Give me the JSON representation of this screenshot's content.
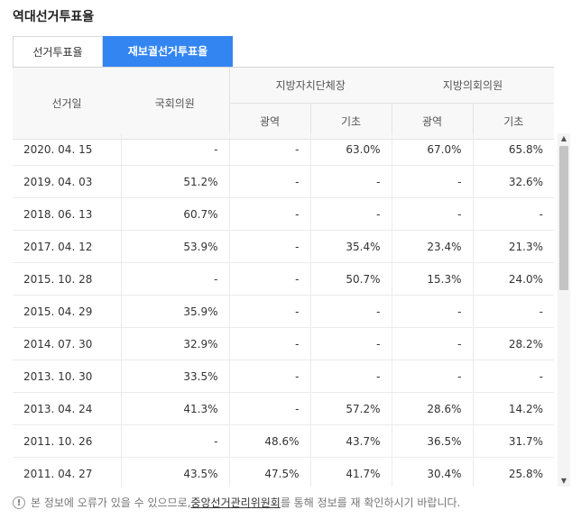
{
  "page_title": "역대선거투표율",
  "tabs": [
    {
      "label": "선거투표율",
      "active": false
    },
    {
      "label": "재보궐선거투표율",
      "active": true
    }
  ],
  "header": {
    "date": "선거일",
    "national_assembly": "국회의원",
    "local_head": "지방자치단체장",
    "local_council": "지방의회의원",
    "metro": "광역",
    "basic": "기초"
  },
  "rows": [
    [
      "2020. 04. 15",
      "-",
      "-",
      "63.0%",
      "67.0%",
      "65.8%"
    ],
    [
      "2019. 04. 03",
      "51.2%",
      "-",
      "-",
      "-",
      "32.6%"
    ],
    [
      "2018. 06. 13",
      "60.7%",
      "-",
      "-",
      "-",
      "-"
    ],
    [
      "2017. 04. 12",
      "53.9%",
      "-",
      "35.4%",
      "23.4%",
      "21.3%"
    ],
    [
      "2015. 10. 28",
      "-",
      "-",
      "50.7%",
      "15.3%",
      "24.0%"
    ],
    [
      "2015. 04. 29",
      "35.9%",
      "-",
      "-",
      "-",
      "-"
    ],
    [
      "2014. 07. 30",
      "32.9%",
      "-",
      "-",
      "-",
      "28.2%"
    ],
    [
      "2013. 10. 30",
      "33.5%",
      "-",
      "-",
      "-",
      "-"
    ],
    [
      "2013. 04. 24",
      "41.3%",
      "-",
      "57.2%",
      "28.6%",
      "14.2%"
    ],
    [
      "2011. 10. 26",
      "-",
      "48.6%",
      "43.7%",
      "36.5%",
      "31.7%"
    ],
    [
      "2011. 04. 27",
      "43.5%",
      "47.5%",
      "41.7%",
      "30.4%",
      "25.8%"
    ]
  ],
  "notice": {
    "prefix": "본 정보에 오류가 있을 수 있으므로, ",
    "link": "중앙선거관리위원회",
    "suffix": "를 통해 정보를 재 확인하시기 바랍니다."
  },
  "icons": {
    "warning": "warning-icon",
    "scroll_up": "scroll-up-icon",
    "scroll_down": "scroll-down-icon"
  },
  "colors": {
    "active_tab": "#3385f2"
  }
}
